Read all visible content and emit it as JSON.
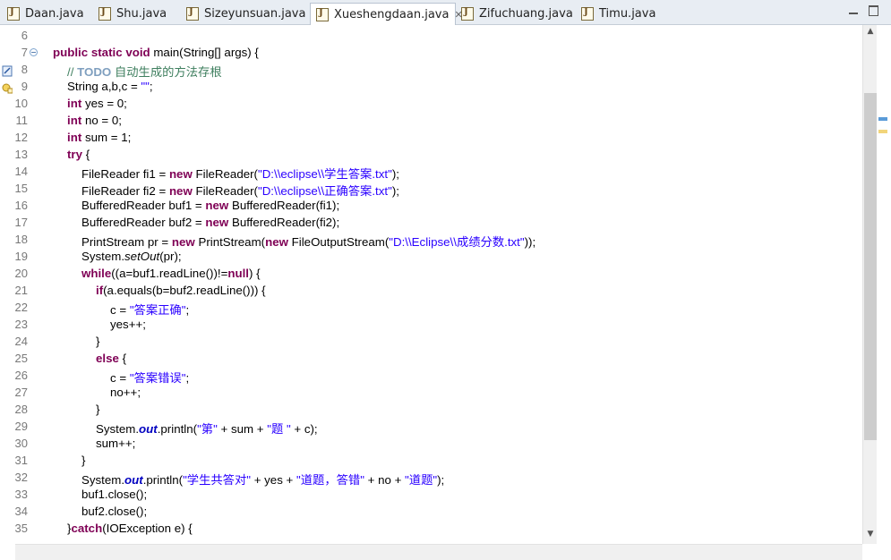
{
  "tabs": [
    {
      "label": "Daan.java"
    },
    {
      "label": "Shu.java"
    },
    {
      "label": "Sizeyunsuan.java"
    },
    {
      "label": "Xueshengdaan.java",
      "active": true
    },
    {
      "label": "Zifuchuang.java"
    },
    {
      "label": "Timu.java"
    }
  ],
  "line_numbers": [
    "6",
    "7",
    "8",
    "9",
    "10",
    "11",
    "12",
    "13",
    "14",
    "15",
    "16",
    "17",
    "18",
    "19",
    "20",
    "21",
    "22",
    "23",
    "24",
    "25",
    "26",
    "27",
    "28",
    "29",
    "30",
    "31",
    "32",
    "33",
    "34",
    "35"
  ],
  "code": {
    "l7_public": "public",
    "l7_static": "static",
    "l7_void": "void",
    "l7_rest": " main(String[] args) {",
    "l8_comment": "// ",
    "l8_todo": "TODO",
    "l8_rest": " 自动生成的方法存根",
    "l9_a": "String a,b,c = ",
    "l9_str": "\"\"",
    "l9_b": ";",
    "l10_kw": "int",
    "l10_rest": " yes = 0;",
    "l11_kw": "int",
    "l11_rest": " no = 0;",
    "l12_kw": "int",
    "l12_rest": " sum = 1;",
    "l13_kw": "try",
    "l13_rest": " {",
    "l14_a": "FileReader fi1 = ",
    "l14_new": "new",
    "l14_b": " FileReader(",
    "l14_str": "\"D:\\\\eclipse\\\\学生答案.txt\"",
    "l14_c": ");",
    "l15_a": "FileReader fi2 = ",
    "l15_new": "new",
    "l15_b": " FileReader(",
    "l15_str": "\"D:\\\\eclipse\\\\正确答案.txt\"",
    "l15_c": ");",
    "l16_a": "BufferedReader buf1 = ",
    "l16_new": "new",
    "l16_b": " BufferedReader(fi1);",
    "l17_a": "BufferedReader buf2 = ",
    "l17_new": "new",
    "l17_b": " BufferedReader(fi2);",
    "l18_a": "PrintStream pr = ",
    "l18_new": "new",
    "l18_b": " PrintStream(",
    "l18_new2": "new",
    "l18_c": " FileOutputStream(",
    "l18_str": "\"D:\\\\Eclipse\\\\成绩分数.txt\"",
    "l18_d": "));",
    "l19_a": "System.",
    "l19_method": "setOut",
    "l19_b": "(pr);",
    "l20_kw": "while",
    "l20_a": "((a=buf1.readLine())!=",
    "l20_null": "null",
    "l20_b": ") {",
    "l21_kw": "if",
    "l21_rest": "(a.equals(b=buf2.readLine())) {",
    "l22_a": "c = ",
    "l22_str": "\"答案正确\"",
    "l22_b": ";",
    "l23": "yes++;",
    "l24": "}",
    "l25_kw": "else",
    "l25_rest": " {",
    "l26_a": "c = ",
    "l26_str": "\"答案错误\"",
    "l26_b": ";",
    "l27": "no++;",
    "l28": "}",
    "l29_a": "System.",
    "l29_out": "out",
    "l29_b": ".println(",
    "l29_s1": "\"第\"",
    "l29_c": " + sum + ",
    "l29_s2": "\"题 \"",
    "l29_d": " + c);",
    "l30": "sum++;",
    "l31": "}",
    "l32_a": "System.",
    "l32_out": "out",
    "l32_b": ".println(",
    "l32_s1": "\"学生共答对\"",
    "l32_c": " + yes + ",
    "l32_s2": "\"道题，答错\"",
    "l32_d": " + no + ",
    "l32_s3": "\"道题\"",
    "l32_e": ");",
    "l33": "buf1.close();",
    "l34": "buf2.close();",
    "l35_a": "}",
    "l35_kw": "catch",
    "l35_b": "(IOException e) {"
  },
  "colors": {
    "keyword": "#7f0055",
    "string": "#2a00ff",
    "comment": "#3f7f5f",
    "static_field": "#0000c0"
  }
}
